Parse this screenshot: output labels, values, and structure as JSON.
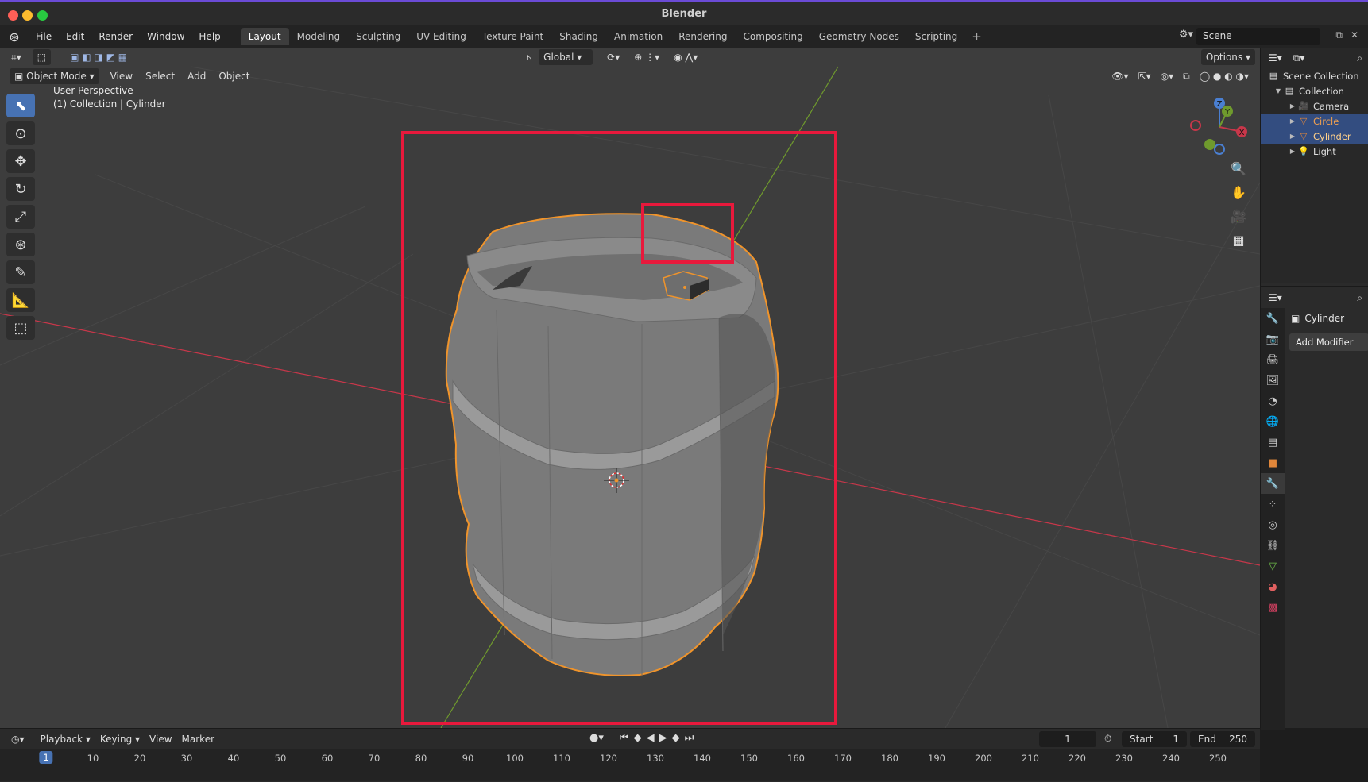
{
  "window": {
    "title": "Blender"
  },
  "menu": {
    "items": [
      "File",
      "Edit",
      "Render",
      "Window",
      "Help"
    ],
    "workspaces": [
      "Layout",
      "Modeling",
      "Sculpting",
      "UV Editing",
      "Texture Paint",
      "Shading",
      "Animation",
      "Rendering",
      "Compositing",
      "Geometry Nodes",
      "Scripting"
    ],
    "active_workspace": "Layout",
    "add_workspace": "+",
    "scene": "Scene"
  },
  "viewport": {
    "mode": "Object Mode",
    "menus": [
      "View",
      "Select",
      "Add",
      "Object"
    ],
    "transform_orientation": "Global",
    "options_label": "Options",
    "overlay_line1": "User Perspective",
    "overlay_line2": "(1) Collection | Cylinder",
    "gizmo": {
      "x": "X",
      "y": "Y",
      "z": "Z"
    }
  },
  "outliner": {
    "root": "Scene Collection",
    "collection": "Collection",
    "items": [
      {
        "label": "Camera",
        "icon": "camera-icon",
        "color": "#e0863a",
        "selected": false
      },
      {
        "label": "Circle",
        "icon": "mesh-icon",
        "color": "#e0863a",
        "selected": true
      },
      {
        "label": "Cylinder",
        "icon": "mesh-icon",
        "color": "#e0863a",
        "selected": true
      },
      {
        "label": "Light",
        "icon": "light-icon",
        "color": "#e0863a",
        "selected": false
      }
    ]
  },
  "properties": {
    "object_name": "Cylinder",
    "add_modifier": "Add Modifier",
    "active_tab": "modifier"
  },
  "timeline": {
    "menus": [
      "Playback",
      "Keying",
      "View",
      "Marker"
    ],
    "current_frame": "1",
    "start_label": "Start",
    "start_value": "1",
    "end_label": "End",
    "end_value": "250",
    "ticks": [
      "10",
      "20",
      "30",
      "40",
      "50",
      "60",
      "70",
      "80",
      "90",
      "100",
      "110",
      "120",
      "130",
      "140",
      "150",
      "160",
      "170",
      "180",
      "190",
      "200",
      "210",
      "220",
      "230",
      "240",
      "250"
    ]
  },
  "colors": {
    "selection_outline": "#f0942b",
    "annotation_box": "#e8193c",
    "accent_blue": "#4772b3",
    "axis_x": "#c8374a",
    "axis_y": "#6f9a2d"
  }
}
